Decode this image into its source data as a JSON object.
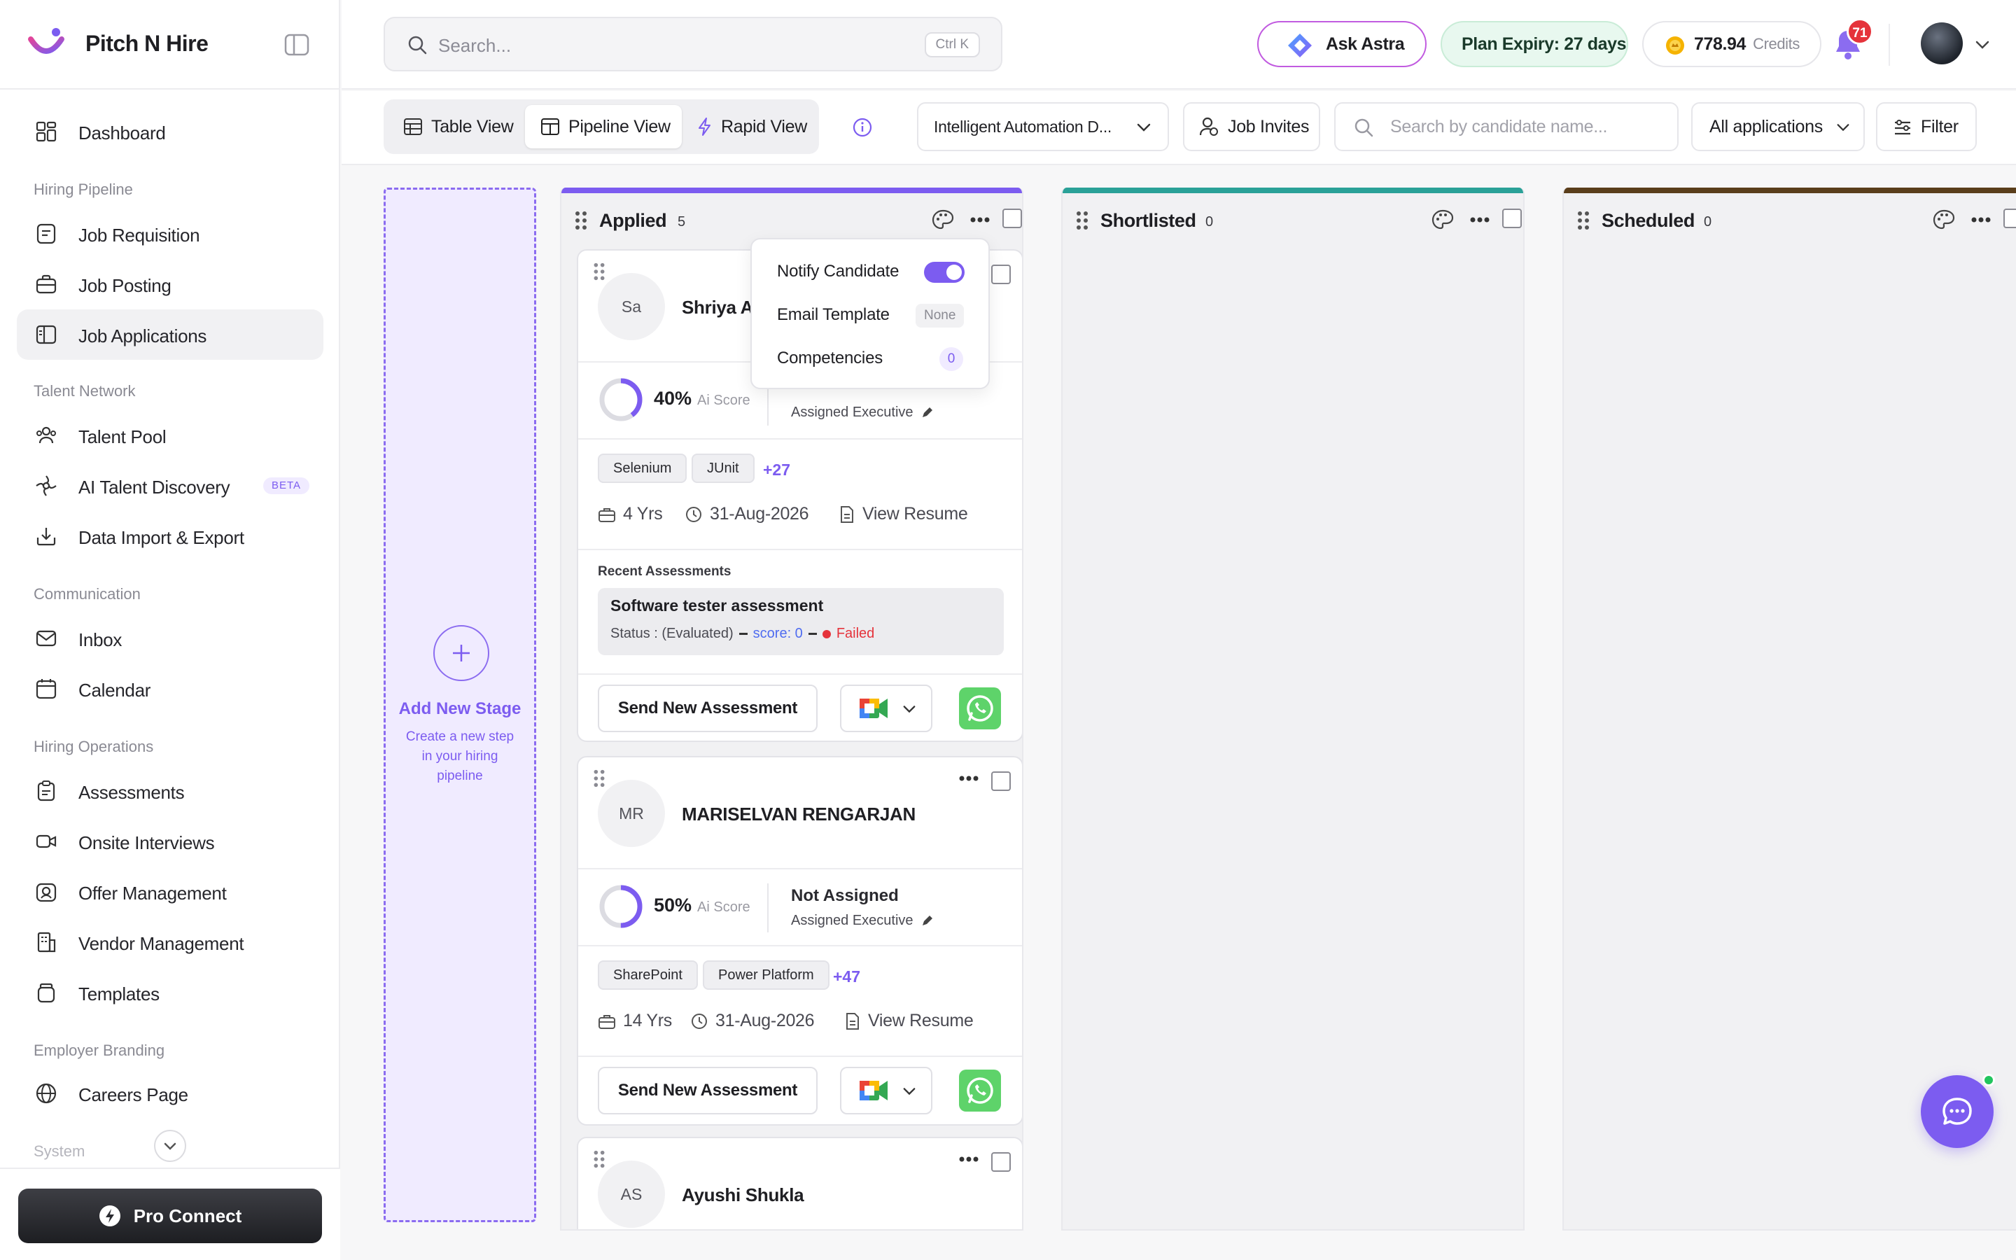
{
  "app": {
    "name": "Pitch N Hire"
  },
  "sidebar": {
    "dashboard": "Dashboard",
    "sections": {
      "hiring_pipeline": "Hiring Pipeline",
      "talent_network": "Talent Network",
      "communication": "Communication",
      "hiring_operations": "Hiring Operations",
      "employer_branding": "Employer Branding",
      "system": "System"
    },
    "items": {
      "job_requisition": "Job Requisition",
      "job_posting": "Job Posting",
      "job_applications": "Job Applications",
      "talent_pool": "Talent Pool",
      "ai_talent_discovery": "AI Talent Discovery",
      "beta": "BETA",
      "data_import_export": "Data Import & Export",
      "inbox": "Inbox",
      "calendar": "Calendar",
      "assessments": "Assessments",
      "onsite_interviews": "Onsite Interviews",
      "offer_management": "Offer Management",
      "vendor_management": "Vendor Management",
      "templates": "Templates",
      "careers_page": "Careers Page"
    },
    "pro_connect": "Pro Connect"
  },
  "header": {
    "search_placeholder": "Search...",
    "search_shortcut": "Ctrl K",
    "ask_astra": "Ask Astra",
    "plan_expiry": "Plan Expiry: 27 days",
    "credits_value": "778.94",
    "credits_label": "Credits",
    "notifications": "71"
  },
  "toolbar": {
    "table_view": "Table View",
    "pipeline_view": "Pipeline View",
    "rapid_view": "Rapid View",
    "job_select": "Intelligent Automation D...",
    "job_invites": "Job Invites",
    "candidate_search_placeholder": "Search by candidate name...",
    "applications_filter": "All applications",
    "filter": "Filter"
  },
  "board": {
    "add_stage_title": "Add New Stage",
    "add_stage_sub": "Create a new step in your hiring pipeline",
    "columns": [
      {
        "name": "Applied",
        "count": "5",
        "color": "#7c5cf0"
      },
      {
        "name": "Shortlisted",
        "count": "0",
        "color": "#2aa198"
      },
      {
        "name": "Scheduled",
        "count": "0",
        "color": "#5a3e1b"
      }
    ],
    "cards": [
      {
        "initials": "Sa",
        "name": "Shriya Ah",
        "score": "40%",
        "score_label": "Ai Score",
        "score_value": 0.4,
        "assigned_exec_label": "Assigned Executive",
        "tags": [
          "Selenium",
          "JUnit"
        ],
        "more_tags": "+27",
        "experience": "4 Yrs",
        "date": "31-Aug-2026",
        "resume": "View Resume",
        "recent_assessments_label": "Recent Assessments",
        "assessment_name": "Software tester assessment",
        "assessment_status": "Status : (Evaluated)",
        "assessment_score": "score: 0",
        "assessment_result": "Failed",
        "send_assessment": "Send New Assessment"
      },
      {
        "initials": "MR",
        "name": "MARISELVAN RENGARJAN",
        "score": "50%",
        "score_label": "Ai Score",
        "score_value": 0.5,
        "assigned_to": "Not Assigned",
        "assigned_exec_label": "Assigned Executive",
        "tags": [
          "SharePoint",
          "Power Platform"
        ],
        "more_tags": "+47",
        "experience": "14 Yrs",
        "date": "31-Aug-2026",
        "resume": "View Resume",
        "send_assessment": "Send New Assessment"
      },
      {
        "initials": "AS",
        "name": "Ayushi Shukla"
      }
    ]
  },
  "popover": {
    "notify_candidate": "Notify Candidate",
    "notify_on": true,
    "email_template": "Email Template",
    "email_template_value": "None",
    "competencies": "Competencies",
    "competencies_count": "0"
  },
  "colors": {
    "accent": "#7c5cf0",
    "failed": "#e5333b",
    "whatsapp": "#5ed36a"
  }
}
